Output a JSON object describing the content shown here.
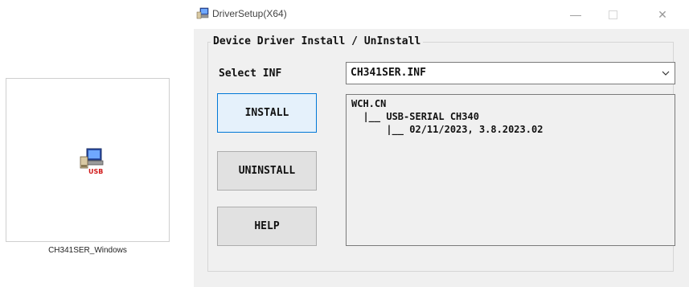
{
  "desktop": {
    "file_caption": "CH341SER_Windows",
    "icon_name": "usb-setup-icon",
    "icon_text": "USB"
  },
  "window": {
    "title": "DriverSetup(X64)",
    "icon_name": "computer-setup-icon",
    "controls": {
      "minimize": "—",
      "close": "✕"
    },
    "group_title": "Device Driver Install / UnInstall",
    "select_label": "Select INF",
    "select_value": "CH341SER.INF",
    "buttons": {
      "install": "INSTALL",
      "uninstall": "UNINSTALL",
      "help": "HELP"
    },
    "info_lines": [
      "WCH.CN",
      "  |__ USB-SERIAL CH340",
      "      |__ 02/11/2023, 3.8.2023.02"
    ]
  },
  "colors": {
    "window_bg": "#f0f0f0",
    "focused_button_bg": "#e5f1fb",
    "focused_button_border": "#0078d7"
  }
}
